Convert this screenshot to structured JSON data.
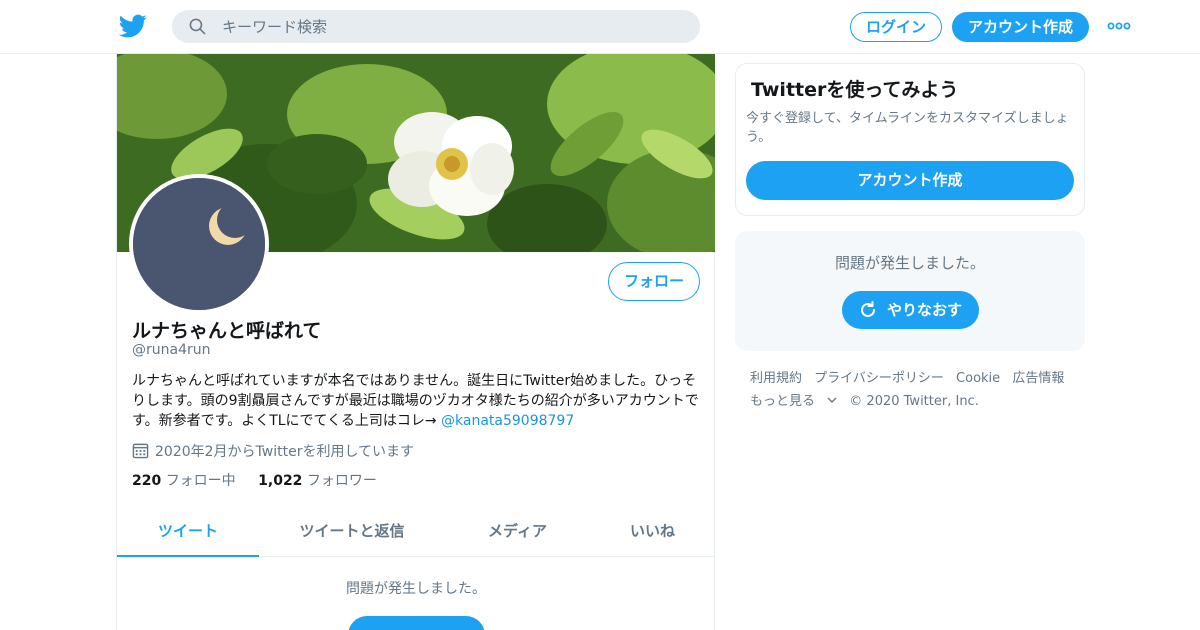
{
  "topbar": {
    "logo_icon": "twitter-bird-icon",
    "search_placeholder": "キーワード検索",
    "login_label": "ログイン",
    "signup_label": "アカウント作成",
    "more_icon": "more-dots-icon"
  },
  "profile": {
    "name": "ルナちゃんと呼ばれて",
    "handle": "@runa4run",
    "bio_text": "ルナちゃんと呼ばれていますが本名ではありません。誕生日にTwitter始めました。ひっそりします。頭の9割贔屓さんですが最近は職場のヅカオタ様たちの紹介が多いアカウントです。新参者です。よくTLにでてくる上司はコレ→ ",
    "bio_link": "@kanata59098797",
    "joined": "2020年2月からTwitterを利用しています",
    "following_count": "220",
    "following_label": "フォロー中",
    "followers_count": "1,022",
    "followers_label": "フォロワー",
    "follow_label": "フォロー"
  },
  "tabs": [
    {
      "label": "ツイート",
      "active": true
    },
    {
      "label": "ツイートと返信",
      "active": false
    },
    {
      "label": "メディア",
      "active": false
    },
    {
      "label": "いいね",
      "active": false
    }
  ],
  "main_error": "問題が発生しました。",
  "sidebar": {
    "signup_card": {
      "title": "Twitterを使ってみよう",
      "desc": "今すぐ登録して、タイムラインをカスタマイズしましょう。",
      "cta": "アカウント作成"
    },
    "error_card": {
      "message": "問題が発生しました。",
      "retry": "やりなおす"
    }
  },
  "footer": {
    "links": [
      "利用規約",
      "プライバシーポリシー",
      "Cookie",
      "広告情報"
    ],
    "more": "もっと見る",
    "copyright": "© 2020 Twitter, Inc."
  },
  "colors": {
    "brand": "#1da1f2",
    "text_secondary": "#657786",
    "border": "#e6ecf0"
  }
}
